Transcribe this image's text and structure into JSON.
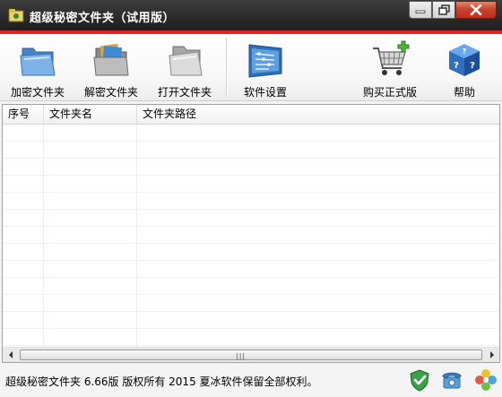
{
  "window": {
    "title": "超级秘密文件夹（试用版）",
    "title_bar_color": "#2a2a2a",
    "accent_color": "#e2242a",
    "controls": [
      "minimize-icon",
      "restore-icon",
      "close-icon"
    ]
  },
  "toolbar": {
    "items": [
      {
        "id": "encrypt",
        "label": "加密文件夹",
        "icon": "blue-folder-icon"
      },
      {
        "id": "decrypt",
        "label": "解密文件夹",
        "icon": "open-folder-icon"
      },
      {
        "id": "open",
        "label": "打开文件夹",
        "icon": "gray-folder-icon"
      },
      {
        "id": "settings",
        "label": "软件设置",
        "icon": "settings-panel-icon"
      },
      {
        "id": "buy",
        "label": "购买正式版",
        "icon": "shopping-cart-icon"
      },
      {
        "id": "help",
        "label": "帮助",
        "icon": "help-cube-icon"
      }
    ]
  },
  "table": {
    "columns": [
      "序号",
      "文件夹名",
      "文件夹路径"
    ],
    "rows": []
  },
  "statusbar": {
    "text": "超级秘密文件夹 6.66版 版权所有 2015 夏冰软件保留全部权利。",
    "icons": [
      "shield-check-icon",
      "telephone-icon",
      "colorful-flower-icon"
    ]
  }
}
